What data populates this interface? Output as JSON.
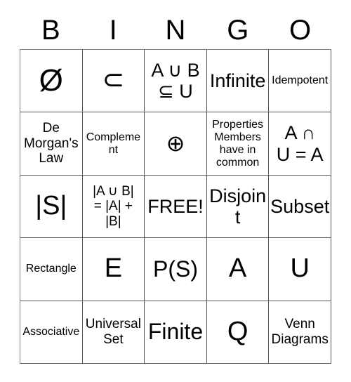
{
  "card": {
    "title_letters": [
      "B",
      "I",
      "N",
      "G",
      "O"
    ],
    "free_space_label": "FREE!",
    "colors": {
      "background": "#ffffff",
      "text": "#000000",
      "grid_line": "#555555"
    }
  },
  "grid": {
    "rows": [
      {
        "cells": [
          {
            "text": "Ø",
            "size": "fs-4xl"
          },
          {
            "text": "⊂",
            "size": "fs-3xl"
          },
          {
            "text": "A ∪ B\n⊆ U",
            "size": "fs-xl"
          },
          {
            "text": "Infinite",
            "size": "fs-xl"
          },
          {
            "text": "Idempotent",
            "size": "fs-sm"
          }
        ]
      },
      {
        "cells": [
          {
            "text": "De\nMorgan's\nLaw",
            "size": "fs-md"
          },
          {
            "text": "Complement",
            "size": "fs-sm"
          },
          {
            "text": "⊕",
            "size": "fs-2xl"
          },
          {
            "text": "Properties\nMembers\nhave in\ncommon",
            "size": "fs-sm"
          },
          {
            "text": "A ∩\nU = A",
            "size": "fs-xl"
          }
        ]
      },
      {
        "cells": [
          {
            "text": "|S|",
            "size": "fs-3xl"
          },
          {
            "text": "|A ∪ B|\n= |A| +\n|B|",
            "size": "fs-md"
          },
          {
            "text": "FREE!",
            "size": "fs-xl"
          },
          {
            "text": "Disjoint",
            "size": "fs-xl"
          },
          {
            "text": "Subset",
            "size": "fs-xl"
          }
        ]
      },
      {
        "cells": [
          {
            "text": "Rectangle",
            "size": "fs-sm"
          },
          {
            "text": "E",
            "size": "fs-3xl"
          },
          {
            "text": "P(S)",
            "size": "fs-2xl"
          },
          {
            "text": "A",
            "size": "fs-3xl"
          },
          {
            "text": "U",
            "size": "fs-3xl"
          }
        ]
      },
      {
        "cells": [
          {
            "text": "Associative",
            "size": "fs-sm"
          },
          {
            "text": "Universal\nSet",
            "size": "fs-md"
          },
          {
            "text": "Finite",
            "size": "fs-2xl"
          },
          {
            "text": "Q",
            "size": "fs-3xl"
          },
          {
            "text": "Venn\nDiagrams",
            "size": "fs-md"
          }
        ]
      }
    ]
  }
}
